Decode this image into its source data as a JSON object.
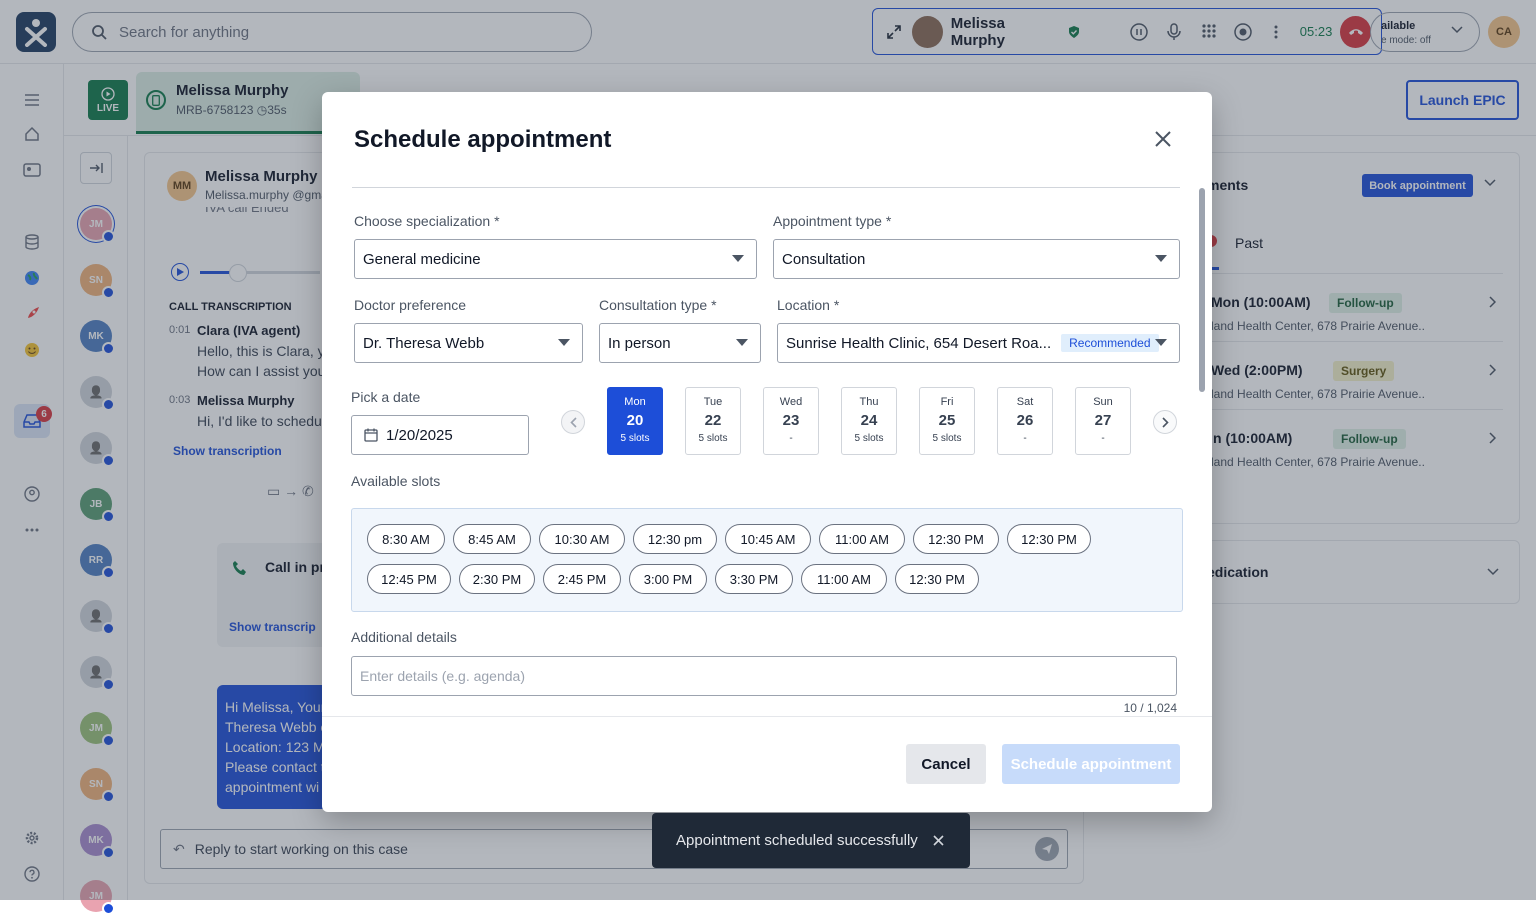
{
  "topbar": {
    "search_placeholder": "Search for anything",
    "call": {
      "caller": "Melissa Murphy",
      "timer": "05:23"
    },
    "status_line1": "ailable",
    "status_line2": "e mode: off",
    "user_initials": "CA"
  },
  "rail": {
    "badge_count": "6"
  },
  "tab": {
    "live_label": "LIVE",
    "name": "Melissa Murphy",
    "mrn": "MRB-6758123",
    "elapsed": "35s"
  },
  "launch_label": "Launch EPIC",
  "contacts": [
    "JM",
    "SN",
    "MK",
    "",
    "",
    "JB",
    "RR",
    "",
    "",
    "JM",
    "SN",
    "MK",
    "JM"
  ],
  "convo": {
    "avatar": "MM",
    "name": "Melissa Murphy",
    "email": "Melissa.murphy @gma",
    "call_ended": "IVA call Ended",
    "transcription_title": "CALL TRANSCRIPTION",
    "lines": [
      {
        "time": "0:01",
        "speaker": "Clara (IVA agent)",
        "text1": "Hello, this is Clara, y",
        "text2": "How can I assist you"
      },
      {
        "time": "0:03",
        "speaker": "Melissa Murphy",
        "text1": "Hi, I'd like to schedu",
        "text2": ""
      }
    ],
    "show_transcription": "Show transcription",
    "call_in_progress": "Call in pr",
    "show_transcription2": "Show transcrip",
    "message_lines": [
      "Hi Melissa, Your",
      "Theresa Webb o",
      "Location: 123 M",
      "Please contact t",
      "appointment wi"
    ],
    "reply_placeholder": "Reply to start working on this case"
  },
  "right": {
    "heading": "ments",
    "book_label": "Book appointment",
    "past_tab": "Past",
    "items": [
      {
        "when": "Mon (10:00AM)",
        "tag": "Follow-up",
        "tag_type": "fu",
        "loc": "land Health Center, 678 Prairie Avenue.."
      },
      {
        "when": "Wed (2:00PM)",
        "tag": "Surgery",
        "tag_type": "sg",
        "loc": "land Health Center, 678 Prairie Avenue.."
      },
      {
        "when": "n (10:00AM)",
        "tag": "Follow-up",
        "tag_type": "fu",
        "loc": "land Health Center, 678 Prairie Avenue.."
      }
    ],
    "medication_heading": "edication"
  },
  "modal": {
    "title": "Schedule appointment",
    "specialization": {
      "label": "Choose specialization",
      "value": "General medicine"
    },
    "appt_type": {
      "label": "Appointment type",
      "value": "Consultation"
    },
    "doctor": {
      "label": "Doctor preference",
      "value": "Dr. Theresa Webb"
    },
    "consult_type": {
      "label": "Consultation type",
      "value": "In person"
    },
    "location": {
      "label": "Location",
      "value": "Sunrise Health Clinic, 654 Desert Roa...",
      "badge": "Recommended"
    },
    "required_mark": "*",
    "date": {
      "label": "Pick a date",
      "value": "1/20/2025"
    },
    "days": [
      {
        "dow": "Mon",
        "num": "20",
        "slots": "5 slots",
        "selected": true
      },
      {
        "dow": "Tue",
        "num": "22",
        "slots": "5 slots",
        "selected": false
      },
      {
        "dow": "Wed",
        "num": "23",
        "slots": "-",
        "selected": false
      },
      {
        "dow": "Thu",
        "num": "24",
        "slots": "5 slots",
        "selected": false
      },
      {
        "dow": "Fri",
        "num": "25",
        "slots": "5 slots",
        "selected": false
      },
      {
        "dow": "Sat",
        "num": "26",
        "slots": "-",
        "selected": false
      },
      {
        "dow": "Sun",
        "num": "27",
        "slots": "-",
        "selected": false
      }
    ],
    "slots_label": "Available slots",
    "slots_row1": [
      "8:30 AM",
      "8:45 AM",
      "10:30 AM",
      "12:30 pm",
      "10:45 AM",
      "11:00 AM",
      "12:30 PM",
      "12:30 PM"
    ],
    "slots_row2": [
      "12:45 PM",
      "2:30 PM",
      "2:45 PM",
      "3:00 PM",
      "3:30 PM",
      "11:00 AM",
      "12:30 PM"
    ],
    "details": {
      "label": "Additional details",
      "placeholder": "Enter details (e.g. agenda)",
      "counter": "10 / 1,024"
    },
    "cancel_label": "Cancel",
    "schedule_label": "Schedule appointment"
  },
  "toast": {
    "message": "Appointment scheduled successfully"
  }
}
